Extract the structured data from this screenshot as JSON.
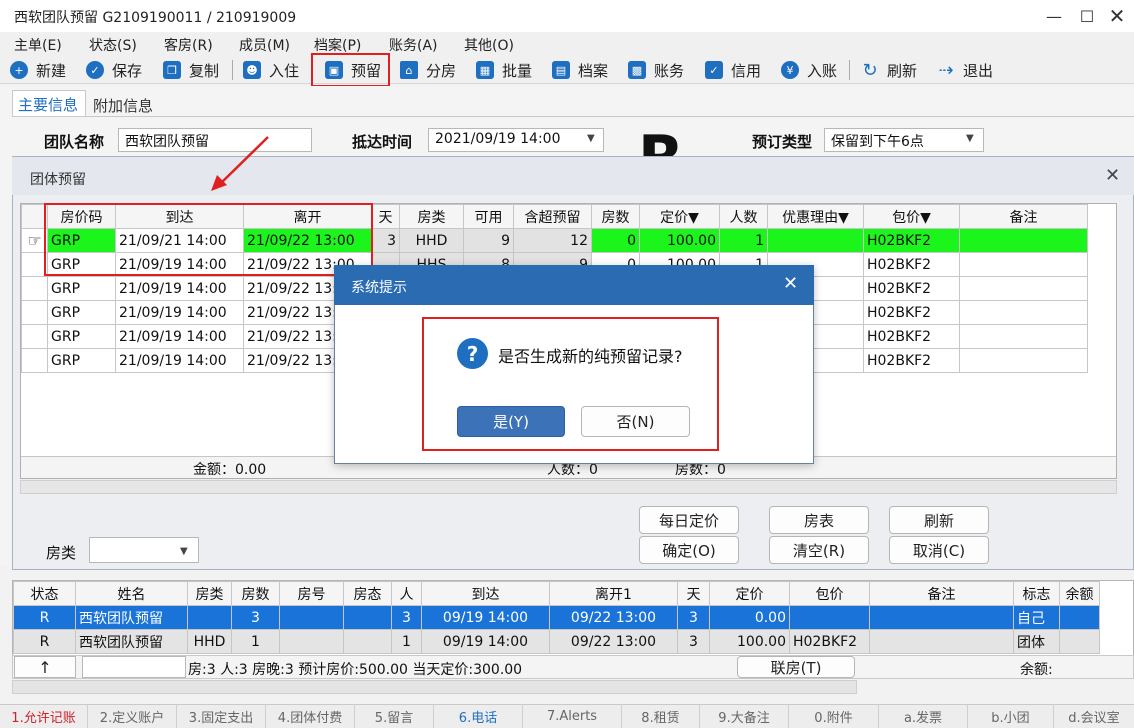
{
  "window": {
    "title": "西软团队预留  G2109190011 / 210919009"
  },
  "menu": [
    "主单(E)",
    "状态(S)",
    "客房(R)",
    "成员(M)",
    "档案(P)",
    "账务(A)",
    "其他(O)"
  ],
  "toolbar": [
    "新建",
    "保存",
    "复制",
    "入住",
    "预留",
    "分房",
    "批量",
    "档案",
    "账务",
    "信用",
    "入账",
    "刷新",
    "退出"
  ],
  "form_tabs": [
    "主要信息",
    "附加信息"
  ],
  "form": {
    "team_name_label": "团队名称",
    "team_name_value": "西软团队预留",
    "arrival_label": "抵达时间",
    "arrival_value": "2021/09/19 14:00",
    "booking_type_label": "预订类型",
    "booking_type_value": "保留到下午6点",
    "big_letter": "R"
  },
  "panel": {
    "title": "团体预留"
  },
  "grid": {
    "headers": [
      "房价码",
      "到达",
      "离开",
      "天",
      "房类",
      "可用",
      "含超预留",
      "房数",
      "定价▼",
      "人数",
      "优惠理由▼",
      "包价▼",
      "备注"
    ],
    "rows": [
      [
        "GRP",
        "21/09/21 14:00",
        "21/09/22 13:00",
        "3",
        "HHD",
        "9",
        "12",
        "0",
        "100.00",
        "1",
        "",
        "H02BKF2",
        ""
      ],
      [
        "GRP",
        "21/09/19 14:00",
        "21/09/22 13:00",
        "",
        "HHS",
        "8",
        "9",
        "0",
        "100.00",
        "1",
        "",
        "H02BKF2",
        ""
      ],
      [
        "GRP",
        "21/09/19 14:00",
        "21/09/22 13:",
        "",
        "",
        "",
        "",
        "",
        "",
        "",
        "",
        "H02BKF2",
        ""
      ],
      [
        "GRP",
        "21/09/19 14:00",
        "21/09/22 13:",
        "",
        "",
        "",
        "",
        "",
        "",
        "",
        "",
        "H02BKF2",
        ""
      ],
      [
        "GRP",
        "21/09/19 14:00",
        "21/09/22 13:",
        "",
        "",
        "",
        "",
        "",
        "",
        "",
        "",
        "H02BKF2",
        ""
      ],
      [
        "GRP",
        "21/09/19 14:00",
        "21/09/22 13:",
        "",
        "",
        "",
        "",
        "",
        "",
        "",
        "",
        "H02BKF2",
        ""
      ]
    ],
    "footer_amount": "金额：0.00",
    "footer_people": "人数：0",
    "footer_rooms": "房数：0"
  },
  "panel_buttons": [
    "每日定价",
    "房表",
    "刷新",
    "确定(O)",
    "清空(R)",
    "取消(C)"
  ],
  "room_type_label": "房类",
  "dialog": {
    "title": "系统提示",
    "message": "是否生成新的纯预留记录?",
    "yes": "是(Y)",
    "no": "否(N)"
  },
  "bottom": {
    "headers": [
      "状态",
      "姓名",
      "房类",
      "房数",
      "房号",
      "房态",
      "人",
      "到达",
      "离开1",
      "天",
      "定价",
      "包价",
      "备注",
      "标志",
      "余额"
    ],
    "rows": [
      [
        "R",
        "西软团队预留",
        "",
        "3",
        "",
        "",
        "3",
        "09/19 14:00",
        "09/22 13:00",
        "3",
        "0.00",
        "",
        "",
        "自己",
        ""
      ],
      [
        "R",
        "西软团队预留",
        "HHD",
        "1",
        "",
        "",
        "1",
        "09/19 14:00",
        "09/22 13:00",
        "3",
        "100.00",
        "H02BKF2",
        "",
        "团体",
        ""
      ]
    ],
    "summary": "房:3  人:3  房晚:3  预计房价:500.00  当天定价:300.00",
    "arrow": "↑",
    "join_button": "联房(T)",
    "balance_label": "余额:"
  },
  "status_tabs": [
    "1.允许记账",
    "2.定义账户",
    "3.固定支出",
    "4.团体付费",
    "5.留言",
    "6.电话",
    "7.Alerts",
    "8.租赁",
    "9.大备注",
    "0.附件",
    "a.发票",
    "b.小团",
    "d.会议室"
  ]
}
